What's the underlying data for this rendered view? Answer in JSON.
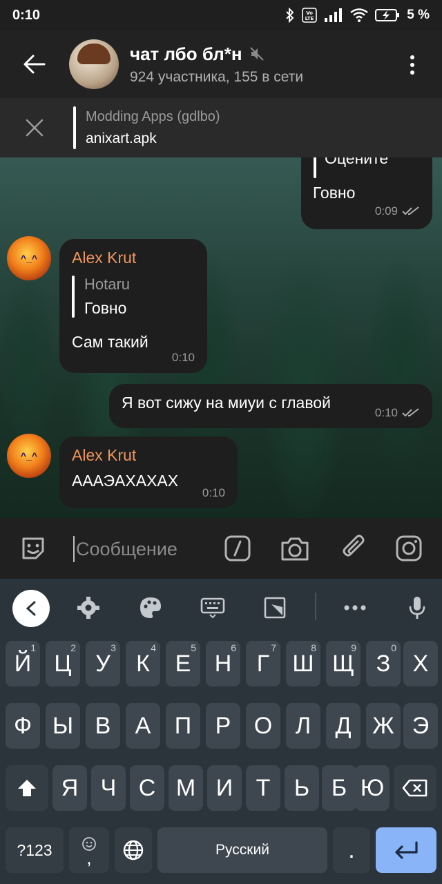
{
  "status": {
    "time": "0:10",
    "battery": "5 %",
    "volte": "Vo LTE"
  },
  "header": {
    "title": "чат лбо бл*н",
    "subtitle": "924 участника, 155 в сети"
  },
  "pinned": {
    "title": "Modding Apps (gdlbo)",
    "body": "anixart.apk"
  },
  "messages": [
    {
      "reply_text": "Оцените",
      "text": "Говно",
      "time": "0:09"
    },
    {
      "sender": "Alex Krut",
      "reply_name": "Hotaru",
      "reply_text": "Говно",
      "text": "Сам такий",
      "time": "0:10",
      "avatar_text": "^_^"
    },
    {
      "text": "Я вот сижу на миуи с главой",
      "time": "0:10"
    },
    {
      "sender": "Alex Krut",
      "text": "АААЭАХАХАХ",
      "time": "0:10",
      "avatar_text": "^_^"
    }
  ],
  "input": {
    "placeholder": "Сообщение"
  },
  "keyboard": {
    "row1": [
      {
        "k": "Й",
        "s": "1"
      },
      {
        "k": "Ц",
        "s": "2"
      },
      {
        "k": "У",
        "s": "3"
      },
      {
        "k": "К",
        "s": "4"
      },
      {
        "k": "Е",
        "s": "5"
      },
      {
        "k": "Н",
        "s": "6"
      },
      {
        "k": "Г",
        "s": "7"
      },
      {
        "k": "Ш",
        "s": "8"
      },
      {
        "k": "Щ",
        "s": "9"
      },
      {
        "k": "З",
        "s": "0"
      },
      {
        "k": "Х",
        "s": ""
      }
    ],
    "row2": [
      "Ф",
      "Ы",
      "В",
      "А",
      "П",
      "Р",
      "О",
      "Л",
      "Д",
      "Ж",
      "Э"
    ],
    "row3": [
      "Я",
      "Ч",
      "С",
      "М",
      "И",
      "Т",
      "Ь",
      "Б",
      "Ю"
    ],
    "sym_label": "?123",
    "comma": ",",
    "space_label": "Русский",
    "period": "."
  }
}
